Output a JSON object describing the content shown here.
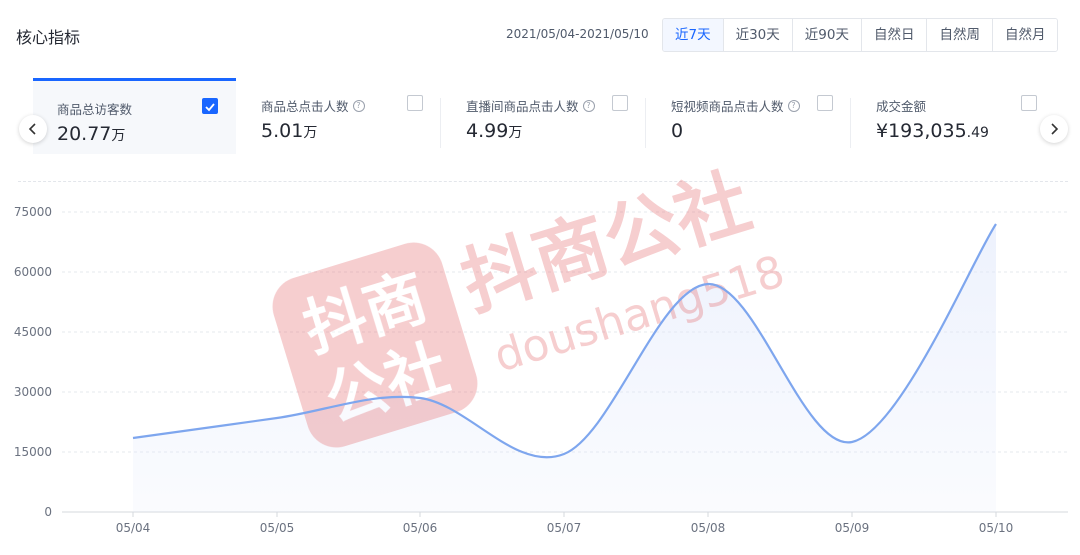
{
  "header": {
    "title": "核心指标",
    "date_range": "2021/05/04-2021/05/10",
    "tabs": [
      "近7天",
      "近30天",
      "近90天",
      "自然日",
      "自然周",
      "自然月"
    ],
    "active_tab": 0
  },
  "metrics": [
    {
      "label": "商品总访客数",
      "value_main": "20.77",
      "value_unit": "万",
      "help": false,
      "checked": true
    },
    {
      "label": "商品总点击人数",
      "value_main": "5.01",
      "value_unit": "万",
      "help": true,
      "checked": false
    },
    {
      "label": "直播间商品点击人数",
      "value_main": "4.99",
      "value_unit": "万",
      "help": true,
      "checked": false
    },
    {
      "label": "短视频商品点击人数",
      "value_main": "0",
      "value_unit": "",
      "help": true,
      "checked": false
    },
    {
      "label": "成交金额",
      "value_main": "¥193,035",
      "value_unit": ".49",
      "help": false,
      "checked": false
    }
  ],
  "icons": {
    "prev": "chevron-left-icon",
    "next": "chevron-right-icon",
    "help": "question-circle-icon",
    "check": "checkmark-icon"
  },
  "colors": {
    "accent": "#1966ff",
    "line": "#7ea6ee",
    "watermark": "#e2646a"
  },
  "watermark": {
    "text_cn": "抖商公社",
    "text_en": "doushang518",
    "badge_top": "抖商",
    "badge_bottom": "公社"
  },
  "chart_data": {
    "type": "line",
    "categories": [
      "05/04",
      "05/05",
      "05/06",
      "05/07",
      "05/08",
      "05/09",
      "05/10"
    ],
    "series": [
      {
        "values": [
          18500,
          23500,
          28500,
          14500,
          57000,
          17500,
          72000
        ]
      }
    ],
    "yticks": [
      "0",
      "15000",
      "30000",
      "45000",
      "60000",
      "75000"
    ],
    "ylim": [
      0,
      75000
    ],
    "grid": true,
    "smooth": true,
    "area_fill": true
  }
}
